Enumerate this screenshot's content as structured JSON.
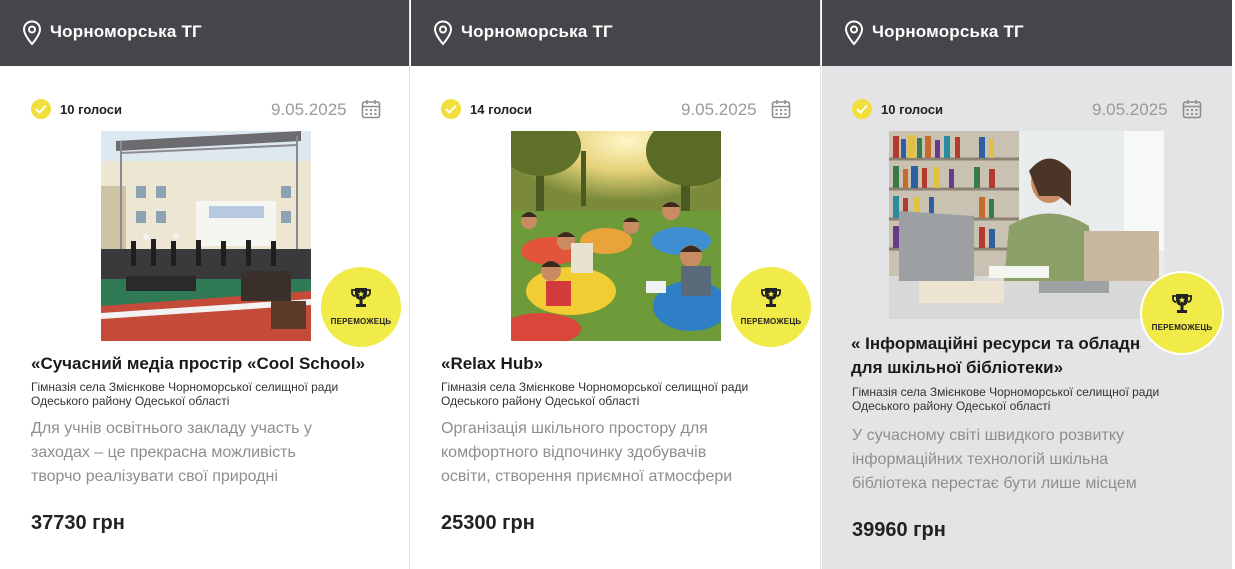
{
  "cards": [
    {
      "location": "Чорноморська ТГ",
      "votes": "10 голоси",
      "date": "9.05.2025",
      "badge": "ПЕРЕМОЖЕЦЬ",
      "title": "«Сучасний медіа простір «Cool School»",
      "school_line1": "Гімназія села Змієнкове Чорноморської селищної ради",
      "school_line2": "Одеського району Одеської області",
      "desc_line1": "Для учнів освітнього закладу участь у",
      "desc_line2": "заходах – це прекрасна можливість",
      "desc_line3": "творчо реалізувати свої природні",
      "price": "37730 грн"
    },
    {
      "location": "Чорноморська ТГ",
      "votes": "14 голоси",
      "date": "9.05.2025",
      "badge": "ПЕРЕМОЖЕЦЬ",
      "title": "«Relax Hub»",
      "school_line1": "Гімназія села Змієнкове Чорноморської селищної ради",
      "school_line2": "Одеського району Одеської області",
      "desc_line1": "Організація шкільного простору для",
      "desc_line2": "комфортного відпочинку здобувачів",
      "desc_line3": "освіти, створення приємної атмосфери",
      "price": "25300 грн"
    },
    {
      "location": "Чорноморська ТГ",
      "votes": "10 голоси",
      "date": "9.05.2025",
      "badge": "ПЕРЕМОЖЕЦЬ",
      "title_line1": "« Інформаційні ресурси та обладнання",
      "title_line2": "для шкільної бібліотеки»",
      "school_line1": "Гімназія села Змієнкове Чорноморської селищної ради",
      "school_line2": "Одеського району Одеської області",
      "desc_line1": "У сучасному світі швидкого розвитку",
      "desc_line2": "інформаційних технологій шкільна",
      "desc_line3": "бібліотека перестає бути лише місцем",
      "price": "39960 грн"
    }
  ],
  "colors": {
    "header_bg": "#464549",
    "accent_yellow": "#f2df3b",
    "card3_bg": "#e4e4e6"
  }
}
